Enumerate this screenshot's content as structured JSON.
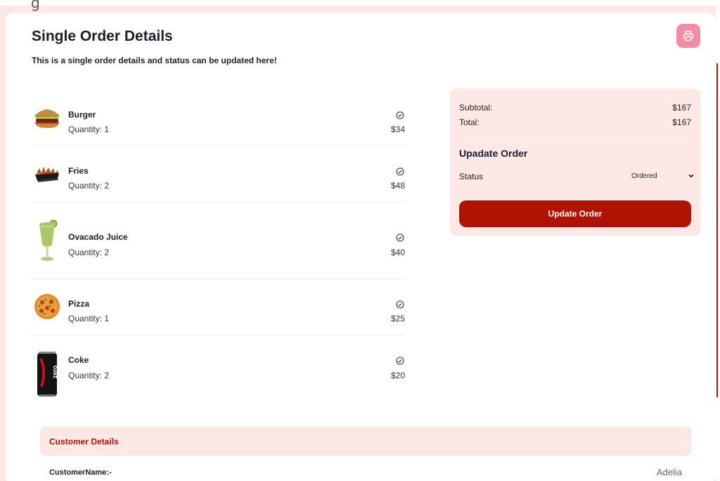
{
  "header": {
    "title": "Single Order Details",
    "subtitle": "This is a single order details and status can be updated here!",
    "print_icon": "printer-icon"
  },
  "items": [
    {
      "name": "Burger",
      "quantity": "Quantity: 1",
      "price": "$34",
      "icon": "burger-icon"
    },
    {
      "name": "Fries",
      "quantity": "Quantity: 2",
      "price": "$48",
      "icon": "fries-icon"
    },
    {
      "name": "Ovacado Juice",
      "quantity": "Quantity: 2",
      "price": "$40",
      "icon": "juice-icon"
    },
    {
      "name": "Pizza",
      "quantity": "Quantity: 1",
      "price": "$25",
      "icon": "pizza-icon"
    },
    {
      "name": "Coke",
      "quantity": "Quantity: 2",
      "price": "$20",
      "icon": "coke-can-icon"
    }
  ],
  "summary": {
    "subtotal_label": "Subtotal:",
    "subtotal_value": "$167",
    "total_label": "Total:",
    "total_value": "$167",
    "update_title": "Upadate Order",
    "status_label": "Status",
    "status_value": "Ordered",
    "update_button": "Update Order"
  },
  "customer": {
    "section_title": "Customer Details",
    "name_label": "CustomerName:-",
    "name_value": "Adelia"
  },
  "colors": {
    "accent": "#b01203",
    "panel": "#fde8e6",
    "print_button": "#f48ca3"
  }
}
